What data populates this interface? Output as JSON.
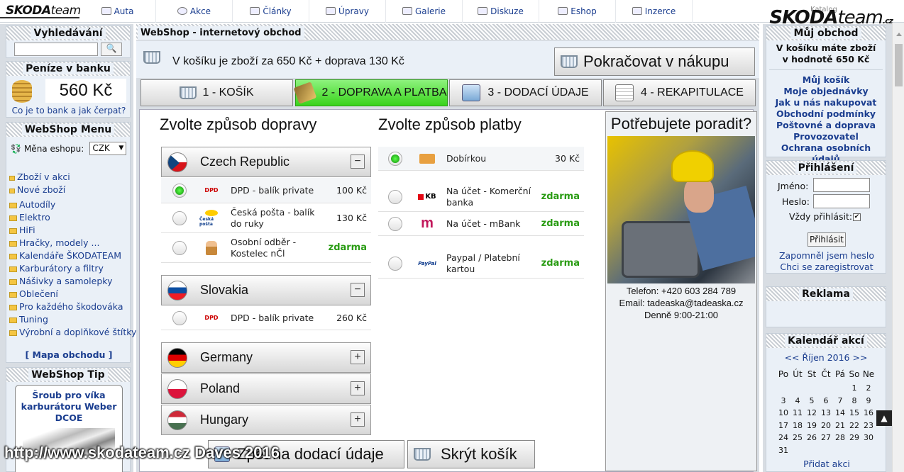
{
  "topnav": {
    "brand_bold": "SKODA",
    "brand_rest": "team",
    "items": [
      "Auta",
      "Akce",
      "Články",
      "Úpravy",
      "Galerie",
      "Diskuze",
      "Eshop",
      "Inzerce"
    ],
    "katalog": "Katalog",
    "brand2_bold": "SKODA",
    "brand2_rest": "team",
    "brand2_suffix": ".cz"
  },
  "left": {
    "search_title": "Vyhledávání",
    "bank_title": "Peníze v banku",
    "bank_amount": "560 Kč",
    "bank_link": "Co je to bank a jak čerpat?",
    "menu_title": "WebShop Menu",
    "currency_label": "Měna eshopu:",
    "currency_value": "CZK",
    "categories": [
      "Zboží v akci",
      "Nové zboží",
      "Autodíly",
      "Elektro",
      "HiFi",
      "Hračky, modely ...",
      "Kalendáře ŠKODATEAM",
      "Karburátory a filtry",
      "Nášivky a samolepky",
      "Oblečení",
      "Pro každého škodováka",
      "Tuning",
      "Výrobní a doplňkové štítky"
    ],
    "map_link": "[ Mapa obchodu ]",
    "tip_title": "WebShop Tip",
    "tip_product": "Šroub pro víka karburátoru Weber DCOE"
  },
  "main": {
    "header": "WebShop - internetový obchod",
    "cart_text": "V košíku je zboží za 650 Kč + doprava 130 Kč",
    "continue_label": "Pokračovat v nákupu",
    "steps": [
      "1 - KOŠÍK",
      "2 - DOPRAVA A PLATBA",
      "3 - DODACÍ ÚDAJE",
      "4 - REKAPITULACE"
    ],
    "shipping_title": "Zvolte způsob dopravy",
    "payment_title": "Zvolte způsob platby",
    "countries": [
      {
        "name": "Czech Republic",
        "toggle": "−",
        "options": [
          {
            "name": "DPD - balík private",
            "price": "100 Kč",
            "logo": "DPD"
          },
          {
            "name": "Česká pošta - balík do ruky",
            "price": "130 Kč",
            "logo": "Česká pošta"
          },
          {
            "name": "Osobní odběr - Kostelec nČl",
            "price": "zdarma",
            "logo": ""
          }
        ]
      },
      {
        "name": "Slovakia",
        "toggle": "−",
        "options": [
          {
            "name": "DPD - balík private",
            "price": "260 Kč",
            "logo": "DPD"
          }
        ]
      },
      {
        "name": "Germany",
        "toggle": "+"
      },
      {
        "name": "Poland",
        "toggle": "+"
      },
      {
        "name": "Hungary",
        "toggle": "+"
      }
    ],
    "payments": [
      {
        "name": "Dobírkou",
        "price": "30 Kč"
      },
      {
        "name": "Na účet - Komerční banka",
        "price": "zdarma",
        "logo": "KB"
      },
      {
        "name": "Na účet - mBank",
        "price": "zdarma",
        "logo": "m"
      },
      {
        "name": "Paypal / Platební kartou",
        "price": "zdarma",
        "logo": "PayPal"
      }
    ],
    "advice_title": "Potřebujete poradit?",
    "phone": "Telefon: +420 603 284 789",
    "email": "Email: tadeaska@tadeaska.cz",
    "hours": "Denně 9:00-21:00",
    "bottom_btn1": "Zpět na dodací údaje",
    "bottom_btn2": "Skrýt košík",
    "watermark": "http://www.skodateam.cz Daves 2016"
  },
  "right": {
    "shop_title": "Můj obchod",
    "shop_text1": "V košíku máte zboží",
    "shop_text2": "v hodnotě 650 Kč",
    "links": [
      "Můj košík",
      "Moje objednávky",
      "Jak u nás nakupovat",
      "Obchodní podmínky",
      "Poštovné a doprava",
      "Provozovatel",
      "Ochrana osobních údajů"
    ],
    "login_title": "Přihlášení",
    "name_label": "Jméno:",
    "pass_label": "Heslo:",
    "remember_label": "Vždy přihlásit:",
    "login_btn": "Přihlásit",
    "forgot": "Zapomněl jsem heslo",
    "register": "Chci se zaregistrovat",
    "ad_title": "Reklama",
    "cal_title": "Kalendář akcí",
    "cal_month": "<< Říjen 2016 >>",
    "cal_days": [
      "Po",
      "Út",
      "St",
      "Čt",
      "Pá",
      "So",
      "Ne"
    ],
    "cal_add": "Přidat akci"
  }
}
